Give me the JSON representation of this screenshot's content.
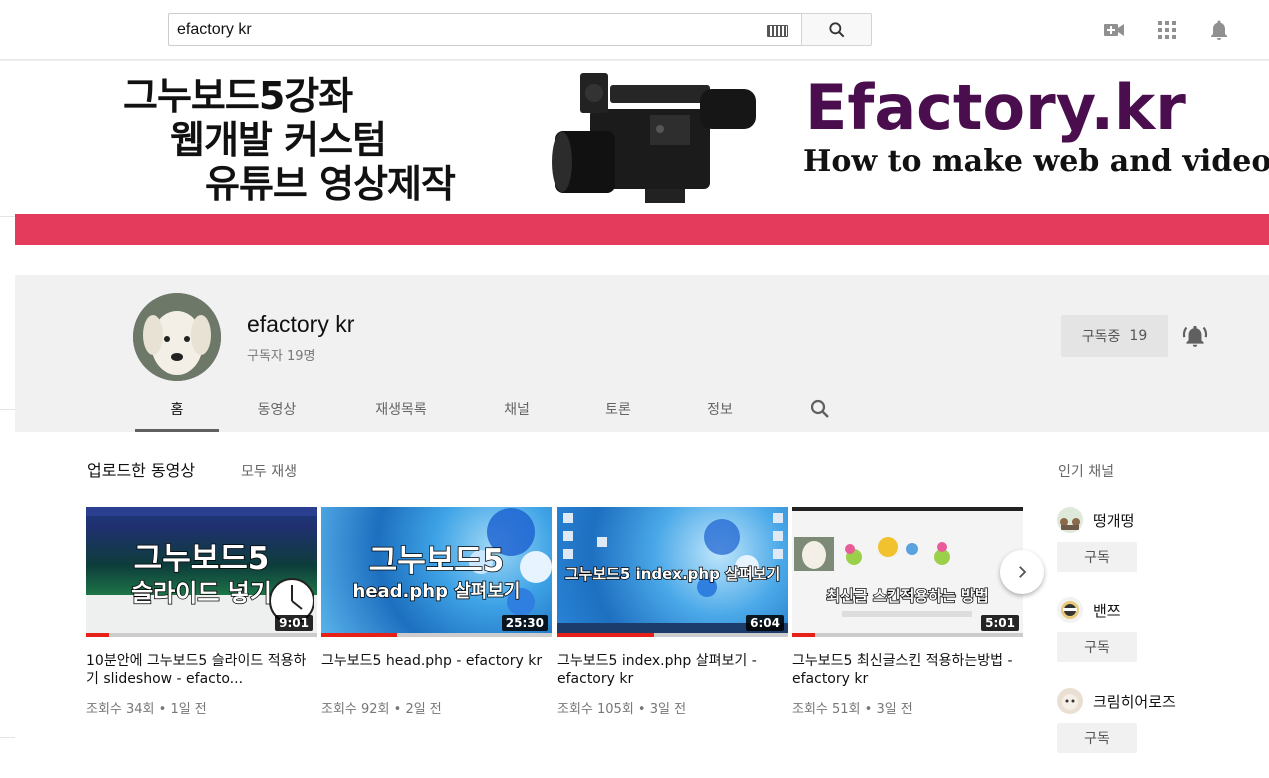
{
  "search": {
    "value": "efactory kr"
  },
  "banner": {
    "line1": "그누보드5강좌",
    "line2": "웹개발 커스텀",
    "line3": "유튜브 영상제작",
    "logo": "Efactory.kr",
    "tagline": "How to make web and video",
    "accent_color": "#e43a5c",
    "logo_color": "#4a0e4e"
  },
  "channel": {
    "name": "efactory kr",
    "subscribers": "구독자 19명",
    "subscribe_label": "구독중",
    "subscribe_count": "19"
  },
  "tabs": [
    {
      "label": "홈",
      "active": true
    },
    {
      "label": "동영상"
    },
    {
      "label": "재생목록"
    },
    {
      "label": "채널"
    },
    {
      "label": "토론"
    },
    {
      "label": "정보"
    }
  ],
  "uploads": {
    "title": "업로드한 동영상",
    "play_all": "모두 재생",
    "videos": [
      {
        "thumb_line1": "그누보드5",
        "thumb_line2": "슬라이드 넣기",
        "duration": "9:01",
        "title": "10분안에 그누보드5 슬라이드 적용하기 slideshow - efacto...",
        "meta": "조회수 34회 • 1일 전",
        "watched": 0.1
      },
      {
        "thumb_line1": "그누보드5",
        "thumb_line2": "head.php 살펴보기",
        "duration": "25:30",
        "title": "그누보드5 head.php - efactory kr",
        "meta": "조회수 92회 • 2일 전",
        "watched": 0.33
      },
      {
        "thumb_line1": "",
        "thumb_line2": "그누보드5 index.php 살펴보기",
        "duration": "6:04",
        "title": "그누보드5 index.php 살펴보기 - efactory kr",
        "meta": "조회수 105회 • 3일 전",
        "watched": 0.42
      },
      {
        "thumb_line1": "",
        "thumb_line2": "최신글 스킨적용하는 방법",
        "duration": "5:01",
        "title": "그누보드5 최신글스킨 적용하는방법 - efactory kr",
        "meta": "조회수 51회 • 3일 전",
        "watched": 0.1
      }
    ]
  },
  "popular": {
    "title": "인기 채널",
    "channels": [
      {
        "name": "떵개떵",
        "subscribe": "구독"
      },
      {
        "name": "밴쯔",
        "subscribe": "구독"
      },
      {
        "name": "크림히어로즈",
        "subscribe": "구독"
      }
    ]
  }
}
